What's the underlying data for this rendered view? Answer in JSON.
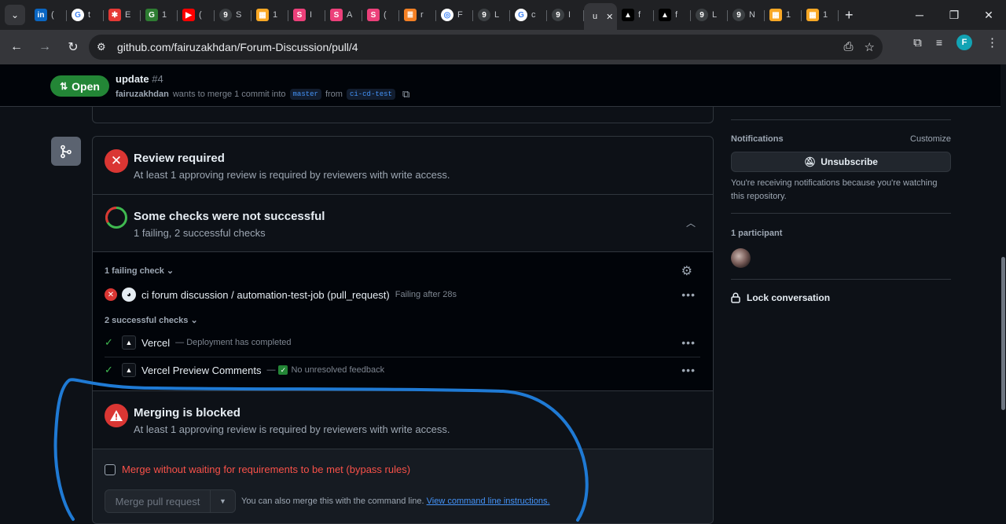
{
  "browser": {
    "tabs": [
      {
        "label": "(",
        "color": "#0a66c2",
        "glyph": "in"
      },
      {
        "label": "t",
        "color": "#ffffff",
        "glyph": "G"
      },
      {
        "label": "E",
        "color": "#e53935",
        "glyph": "✱"
      },
      {
        "label": "1",
        "color": "#2e7d32",
        "glyph": "G"
      },
      {
        "label": "(",
        "color": "#ff0000",
        "glyph": "▶"
      },
      {
        "label": "S",
        "color": "#3c4043",
        "glyph": "9"
      },
      {
        "label": "1",
        "color": "#f9a825",
        "glyph": "▦"
      },
      {
        "label": "I",
        "color": "#ec407a",
        "glyph": "S"
      },
      {
        "label": "A",
        "color": "#ec407a",
        "glyph": "S"
      },
      {
        "label": "(",
        "color": "#ec407a",
        "glyph": "S"
      },
      {
        "label": "r",
        "color": "#f48024",
        "glyph": "≣"
      },
      {
        "label": "F",
        "color": "#ffffff",
        "glyph": "◎"
      },
      {
        "label": "L",
        "color": "#3c4043",
        "glyph": "9"
      },
      {
        "label": "c",
        "color": "#ffffff",
        "glyph": "G"
      },
      {
        "label": "I",
        "color": "#3c4043",
        "glyph": "9"
      },
      {
        "label": "u",
        "color": "#35363a",
        "glyph": "",
        "active": true
      },
      {
        "label": "f",
        "color": "#000000",
        "glyph": "▲"
      },
      {
        "label": "f",
        "color": "#000000",
        "glyph": "▲"
      },
      {
        "label": "L",
        "color": "#3c4043",
        "glyph": "9"
      },
      {
        "label": "N",
        "color": "#3c4043",
        "glyph": "9"
      },
      {
        "label": "1",
        "color": "#f9a825",
        "glyph": "▦"
      },
      {
        "label": "1",
        "color": "#f9a825",
        "glyph": "▦"
      }
    ],
    "url": "github.com/fairuzakhdan/Forum-Discussion/pull/4",
    "profile_initial": "F"
  },
  "pr": {
    "state": "Open",
    "title": "update",
    "number": "#4",
    "author": "fairuzakhdan",
    "merge_text": "wants to merge 1 commit into",
    "base_branch": "master",
    "from_text": "from",
    "head_branch": "ci-cd-test"
  },
  "merge_box": {
    "review": {
      "title": "Review required",
      "desc": "At least 1 approving review is required by reviewers with write access."
    },
    "checks": {
      "title": "Some checks were not successful",
      "desc": "1 failing, 2 successful checks"
    },
    "failing_label": "1 failing check",
    "failing": [
      {
        "name": "ci forum discussion / automation-test-job (pull_request)",
        "meta": "Failing after 28s"
      }
    ],
    "successful_label": "2 successful checks",
    "successful": [
      {
        "name": "Vercel",
        "meta": "— Deployment has completed"
      },
      {
        "name": "Vercel Preview Comments",
        "meta": "No unresolved feedback",
        "dash": "—"
      }
    ],
    "blocked": {
      "title": "Merging is blocked",
      "desc": "At least 1 approving review is required by reviewers with write access."
    },
    "bypass_label": "Merge without waiting for requirements to be met (bypass rules)",
    "merge_button": "Merge pull request",
    "hint_text": "You can also merge this with the command line.",
    "hint_link": "View command line instructions."
  },
  "sidebar": {
    "notifications_label": "Notifications",
    "customize_label": "Customize",
    "unsubscribe_label": "Unsubscribe",
    "notifications_note": "You're receiving notifications because you're watching this repository.",
    "participants_label": "1 participant",
    "lock_label": "Lock conversation"
  },
  "colors": {
    "accent_green": "#238636",
    "danger": "#da3633",
    "link": "#4493f8",
    "annotation": "#1f7ad4"
  }
}
